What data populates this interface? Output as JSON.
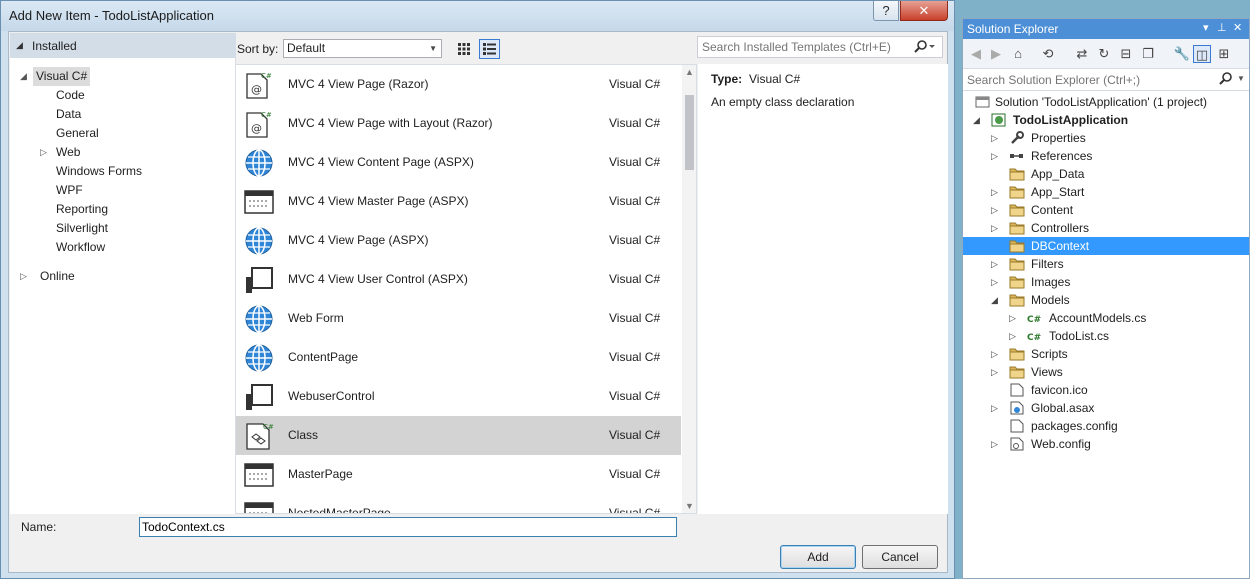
{
  "dialog": {
    "title": "Add New Item - TodoListApplication",
    "help_glyph": "?",
    "close_glyph": "✕",
    "tree": {
      "installed": "Installed",
      "visual_csharp": "Visual C#",
      "items": [
        "Code",
        "Data",
        "General",
        "Web",
        "Windows Forms",
        "WPF",
        "Reporting",
        "Silverlight",
        "Workflow"
      ],
      "online": "Online"
    },
    "sort_label": "Sort by:",
    "sort_value": "Default",
    "search_placeholder": "Search Installed Templates (Ctrl+E)",
    "templates": [
      {
        "name": "MVC 4 View Page (Razor)",
        "lang": "Visual C#",
        "icon": "razor-page-icon"
      },
      {
        "name": "MVC 4 View Page with Layout (Razor)",
        "lang": "Visual C#",
        "icon": "razor-page-icon"
      },
      {
        "name": "MVC 4 View Content Page (ASPX)",
        "lang": "Visual C#",
        "icon": "globe-icon"
      },
      {
        "name": "MVC 4 View Master Page (ASPX)",
        "lang": "Visual C#",
        "icon": "master-page-icon"
      },
      {
        "name": "MVC 4 View Page (ASPX)",
        "lang": "Visual C#",
        "icon": "globe-icon"
      },
      {
        "name": "MVC 4 View User Control (ASPX)",
        "lang": "Visual C#",
        "icon": "user-control-icon"
      },
      {
        "name": "Web Form",
        "lang": "Visual C#",
        "icon": "globe-icon"
      },
      {
        "name": "ContentPage",
        "lang": "Visual C#",
        "icon": "globe-icon"
      },
      {
        "name": "WebuserControl",
        "lang": "Visual C#",
        "icon": "user-control-icon"
      },
      {
        "name": "Class",
        "lang": "Visual C#",
        "icon": "class-icon"
      },
      {
        "name": "MasterPage",
        "lang": "Visual C#",
        "icon": "master-page-icon"
      },
      {
        "name": "NestedMasterPage",
        "lang": "Visual C#",
        "icon": "master-page-icon"
      }
    ],
    "selected_template_index": 9,
    "info": {
      "type_label": "Type:",
      "type_value": "Visual C#",
      "description": "An empty class declaration"
    },
    "name_label": "Name:",
    "name_value": "TodoContext.cs",
    "add_label": "Add",
    "cancel_label": "Cancel"
  },
  "solution_explorer": {
    "title": "Solution Explorer",
    "search_placeholder": "Search Solution Explorer (Ctrl+;)",
    "solution_label": "Solution 'TodoListApplication' (1 project)",
    "project_label": "TodoListApplication",
    "nodes": [
      {
        "label": "Properties",
        "icon": "wrench-icon",
        "expander": "collapsed",
        "depth": 1
      },
      {
        "label": "References",
        "icon": "references-icon",
        "expander": "collapsed",
        "depth": 1
      },
      {
        "label": "App_Data",
        "icon": "folder-icon",
        "expander": "none",
        "depth": 1
      },
      {
        "label": "App_Start",
        "icon": "folder-icon",
        "expander": "collapsed",
        "depth": 1
      },
      {
        "label": "Content",
        "icon": "folder-icon",
        "expander": "collapsed",
        "depth": 1
      },
      {
        "label": "Controllers",
        "icon": "folder-icon",
        "expander": "collapsed",
        "depth": 1
      },
      {
        "label": "DBContext",
        "icon": "folder-icon",
        "expander": "none",
        "depth": 1,
        "selected": true
      },
      {
        "label": "Filters",
        "icon": "folder-icon",
        "expander": "collapsed",
        "depth": 1
      },
      {
        "label": "Images",
        "icon": "folder-icon",
        "expander": "collapsed",
        "depth": 1
      },
      {
        "label": "Models",
        "icon": "folder-icon",
        "expander": "expanded",
        "depth": 1
      },
      {
        "label": "AccountModels.cs",
        "icon": "csharp-file-icon",
        "expander": "collapsed",
        "depth": 2
      },
      {
        "label": "TodoList.cs",
        "icon": "csharp-file-icon",
        "expander": "collapsed",
        "depth": 2
      },
      {
        "label": "Scripts",
        "icon": "folder-icon",
        "expander": "collapsed",
        "depth": 1
      },
      {
        "label": "Views",
        "icon": "folder-icon",
        "expander": "collapsed",
        "depth": 1
      },
      {
        "label": "favicon.ico",
        "icon": "file-icon",
        "expander": "none",
        "depth": 1
      },
      {
        "label": "Global.asax",
        "icon": "global-asax-icon",
        "expander": "collapsed",
        "depth": 1
      },
      {
        "label": "packages.config",
        "icon": "file-icon",
        "expander": "none",
        "depth": 1
      },
      {
        "label": "Web.config",
        "icon": "config-file-icon",
        "expander": "collapsed",
        "depth": 1
      }
    ],
    "csharp_badge": "C#",
    "colors": {
      "title_bg": "#4d8fd6",
      "selection": "#3399ff",
      "folder": "#dcb65a"
    }
  }
}
